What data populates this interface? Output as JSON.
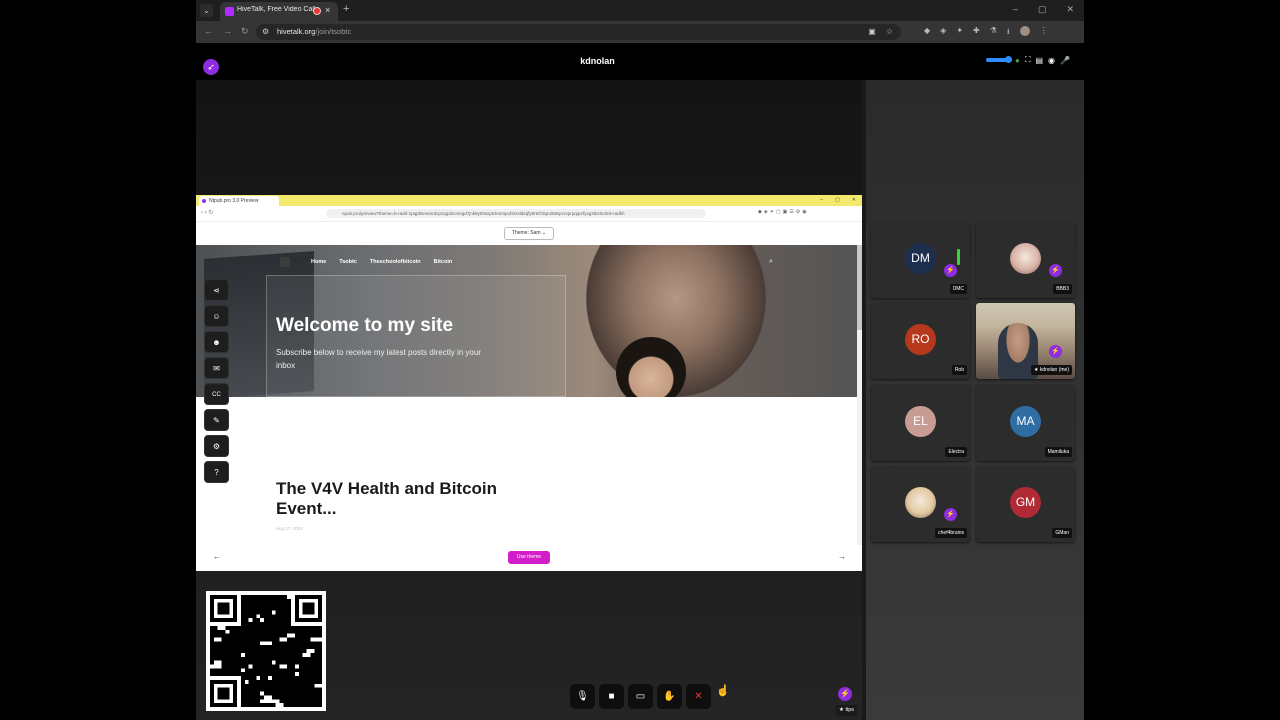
{
  "browser": {
    "tab_title": "HiveTalk, Free Video Calls, M",
    "tab_close": "×",
    "new_tab": "+",
    "url_host": "hivetalk.org",
    "url_path": "/join/tsobtc",
    "window_controls": [
      "–",
      "▢",
      "✕"
    ]
  },
  "header": {
    "room_user": "kdnolan"
  },
  "shared_screen": {
    "inner_tab_title": "Ntpub.pro 3.0 Preview",
    "inner_url": "npub.pro/preview?theme=b-radd-1pqp8smenrdcpzqqd2cmegd7jnk8y00sxptckmmpuhtrxsld2qfy0rtd7dqn258spcrvprpqqsrfyxg3dsr5clmk-radkh",
    "theme_select": "Theme: Sam ⌄",
    "site_nav": [
      "Home",
      "Tsobtc",
      "Theschoolofbitcoin",
      "Bitcoin"
    ],
    "hero_title": "Welcome to my site",
    "hero_subtitle": "Subscribe below to receive my latest posts directly in your inbox",
    "post_title": "The V4V Health and Bitcoin Event...",
    "post_date": "Aug 27, 2024",
    "use_theme_label": "Use theme",
    "arrow_left": "←",
    "arrow_right": "→"
  },
  "side_toolbar": [
    {
      "icon": "share-icon",
      "glyph": "⋖"
    },
    {
      "icon": "emoji-icon",
      "glyph": "☺"
    },
    {
      "icon": "emoji-alt-icon",
      "glyph": "☻"
    },
    {
      "icon": "chat-icon",
      "glyph": "✉"
    },
    {
      "icon": "captions-icon",
      "glyph": "CC"
    },
    {
      "icon": "whiteboard-icon",
      "glyph": "✎"
    },
    {
      "icon": "settings-icon",
      "glyph": "⚙"
    },
    {
      "icon": "help-icon",
      "glyph": "?"
    }
  ],
  "controls": [
    {
      "name": "mic",
      "glyph": "🎙"
    },
    {
      "name": "camera",
      "glyph": "■"
    },
    {
      "name": "screen-share",
      "glyph": "▭"
    },
    {
      "name": "raise-hand",
      "glyph": "✋"
    },
    {
      "name": "leave",
      "glyph": "✕"
    }
  ],
  "tips": {
    "label": "★ tips",
    "bolt": "⚡"
  },
  "participants": [
    {
      "initials": "DM",
      "name": "DMC",
      "color": "#1d2f4e",
      "bolt": true,
      "mic_active": true
    },
    {
      "initials": "",
      "name": "BBB3",
      "color": "#d9b3a8",
      "bolt": true,
      "photo": true
    },
    {
      "initials": "RO",
      "name": "Rob",
      "color": "#b5371c",
      "bolt": false
    },
    {
      "initials": "",
      "name": "★ kdnolan (me)",
      "color": "#c3b59e",
      "bolt": true,
      "video": true
    },
    {
      "initials": "EL",
      "name": "Electra",
      "color": "#c99c93",
      "bolt": false
    },
    {
      "initials": "MA",
      "name": "Mamiluka",
      "color": "#2f6da3",
      "bolt": false
    },
    {
      "initials": "",
      "name": "chef4brains",
      "color": "#e2c9a0",
      "bolt": true,
      "photo": true
    },
    {
      "initials": "GM",
      "name": "GMan",
      "color": "#b02a35",
      "bolt": false
    }
  ],
  "colors": {
    "accent": "#8e2ce0",
    "use_theme": "#d31dc9",
    "inner_tabbar": "#f3e96c"
  }
}
